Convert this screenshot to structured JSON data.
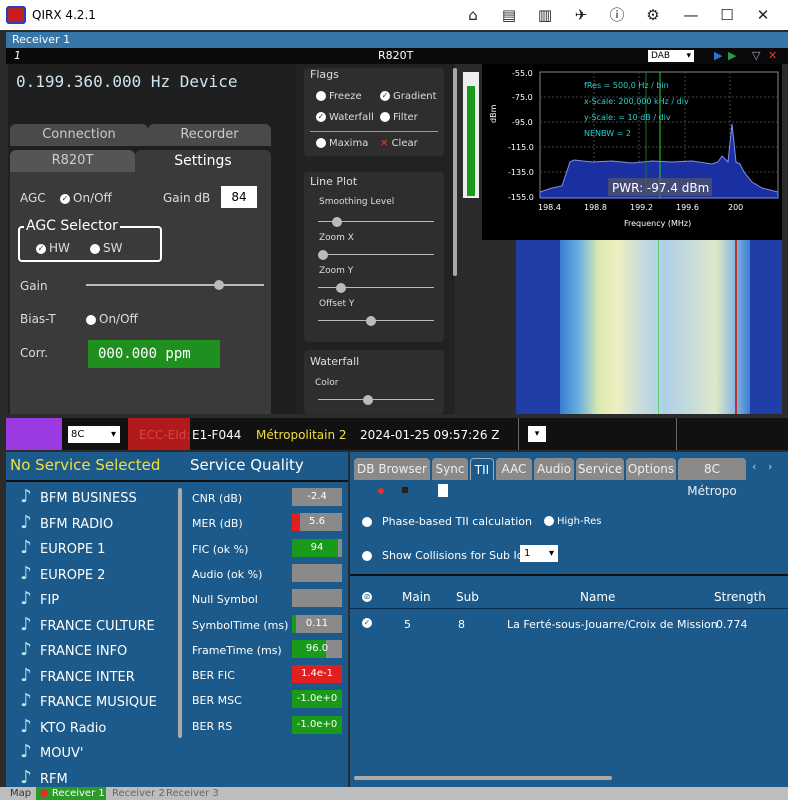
{
  "app": {
    "title": "QIRX 4.2.1"
  },
  "receiver_bar": {
    "label": "Receiver 1"
  },
  "device_bar": {
    "number": "1",
    "device": "R820T",
    "mode": "DAB"
  },
  "left": {
    "frequency": "0.199.360.000 Hz Device",
    "tabs_top": [
      "Connection",
      "Recorder"
    ],
    "tabs_bottom": [
      "R820T",
      "Settings"
    ],
    "agc_label": "AGC",
    "agc_toggle": "On/Off",
    "gain_db_label": "Gain dB",
    "gain_db_value": "84",
    "agc_selector_label": "AGC Selector",
    "hw_label": "HW",
    "sw_label": "SW",
    "gain_label": "Gain",
    "gain_slider": 0.75,
    "biast_label": "Bias-T",
    "biast_toggle": "On/Off",
    "corr_label": "Corr.",
    "corr_value": "000.000 ppm"
  },
  "mid": {
    "flags_title": "Flags",
    "freeze": "Freeze",
    "gradient": "Gradient",
    "waterfall": "Waterfall",
    "filter": "Filter",
    "maxima": "Maxima",
    "clear": "Clear",
    "lineplot_title": "Line Plot",
    "smoothing": "Smoothing Level",
    "zoomx": "Zoom X",
    "zoomy": "Zoom Y",
    "offsety": "Offset Y",
    "waterfall_title": "Waterfall",
    "color": "Color"
  },
  "spectrum": {
    "info": [
      "fRes = 500,0 Hz / bin",
      "x-Scale: 200,000 kHz / div",
      "y-Scale: = 10 dB / div",
      "NENBW = 2"
    ],
    "pwr": "PWR: -97.4 dBm",
    "ylabel": "dBm",
    "xlabel": "Frequency (MHz)",
    "yticks": [
      "-55.0",
      "-75.0",
      "-95.0",
      "-115.0",
      "-135.0",
      "-155.0"
    ],
    "xticks": [
      "198.4",
      "198.8",
      "199.2",
      "199.6",
      "200"
    ]
  },
  "status": {
    "channel": "8C",
    "ecc": "ECC-EId:",
    "eid": "E1-F044",
    "ensemble": "Métropolitain 2",
    "datetime": "2024-01-25  09:57:26 Z"
  },
  "services": {
    "header": "No Service Selected",
    "items": [
      "BFM BUSINESS",
      "BFM RADIO",
      "EUROPE 1",
      "EUROPE 2",
      "FIP",
      "FRANCE CULTURE",
      "FRANCE INFO",
      "FRANCE INTER",
      "FRANCE MUSIQUE",
      "KTO Radio",
      "MOUV'",
      "RFM"
    ]
  },
  "quality": {
    "header": "Service Quality",
    "rows": [
      {
        "label": "CNR (dB)",
        "value": "-2.4"
      },
      {
        "label": "MER (dB)",
        "value": "5.6"
      },
      {
        "label": "FIC (ok %)",
        "value": "94"
      },
      {
        "label": "Audio (ok %)",
        "value": ""
      },
      {
        "label": "Null Symbol",
        "value": ""
      },
      {
        "label": "SymbolTime (ms)",
        "value": "0.11"
      },
      {
        "label": "FrameTime (ms)",
        "value": "96.0"
      },
      {
        "label": "BER FIC",
        "value": "1.4e-1"
      },
      {
        "label": "BER MSC",
        "value": "-1.0e+0"
      },
      {
        "label": "BER RS",
        "value": "-1.0e+0"
      }
    ]
  },
  "tii": {
    "tabs": [
      "DB Browser",
      "Sync",
      "TII",
      "AAC",
      "Audio",
      "Service",
      "Options",
      "8C Métropo"
    ],
    "phase_label": "Phase-based TII calculation",
    "highres_label": "High-Res",
    "collisions_label": "Show Collisions for Sub Id",
    "collisions_value": "1",
    "columns": [
      "Main",
      "Sub",
      "Name",
      "Strength"
    ],
    "row": {
      "main": "5",
      "sub": "8",
      "name": "La Ferté-sous-Jouarre/Croix de Mission",
      "strength": "0.774"
    }
  },
  "bottom_tabs": [
    "Map",
    "Receiver 1",
    "Receiver 2",
    "Receiver 3"
  ]
}
